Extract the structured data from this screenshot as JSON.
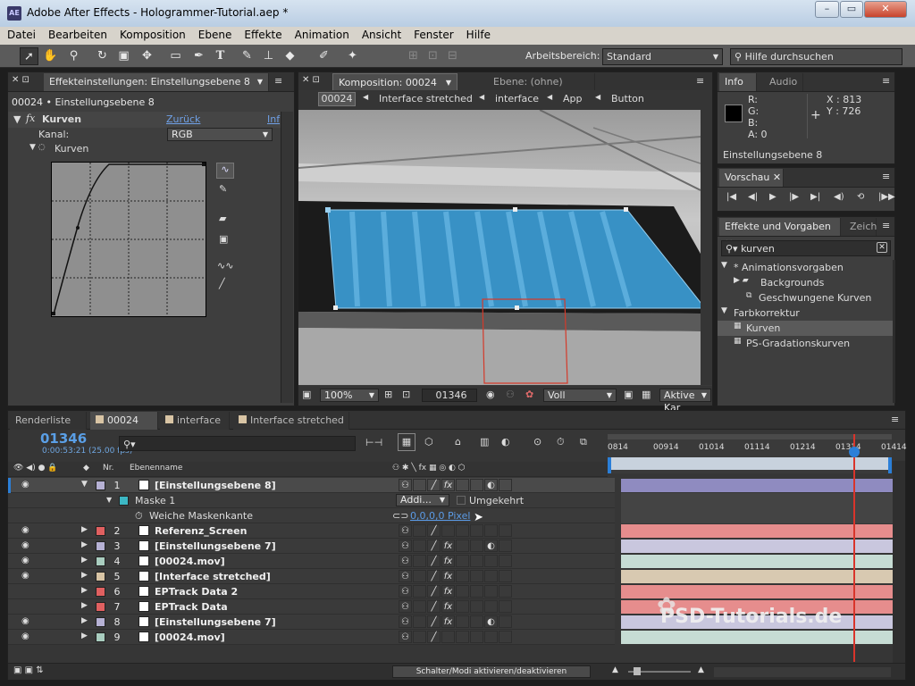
{
  "window": {
    "title": "Adobe After Effects - Hologrammer-Tutorial.aep *",
    "icon_label": "AE"
  },
  "menu": [
    "Datei",
    "Bearbeiten",
    "Komposition",
    "Ebene",
    "Effekte",
    "Animation",
    "Ansicht",
    "Fenster",
    "Hilfe"
  ],
  "toolbar": {
    "workspace_label": "Arbeitsbereich:",
    "workspace_value": "Standard",
    "help_placeholder": "Hilfe durchsuchen"
  },
  "effects_panel": {
    "tab": "Effekteinstellungen: Einstellungsebene 8",
    "breadcrumb": "00024 • Einstellungsebene 8",
    "effect_name": "Kurven",
    "reset": "Zurück",
    "info_link": "Inf",
    "channel_label": "Kanal:",
    "channel_value": "RGB",
    "curves_label": "Kurven"
  },
  "comp_panel": {
    "tab": "Komposition: 00024",
    "tab2": "Ebene: (ohne)",
    "crumbs": [
      "00024",
      "Interface stretched",
      "interface",
      "App",
      "Button"
    ],
    "zoom": "100%",
    "timecode": "01346",
    "resolution": "Voll",
    "camera": "Aktive Kar"
  },
  "info_panel": {
    "tabs": [
      "Info",
      "Audio"
    ],
    "r": "R:",
    "g": "G:",
    "b": "B:",
    "a": "A:  0",
    "x": "X : 813",
    "y": "Y : 726",
    "layer": "Einstellungsebene 8"
  },
  "preview_panel": {
    "tab": "Vorschau"
  },
  "presets_panel": {
    "tabs": [
      "Effekte und Vorgaben",
      "Zeich"
    ],
    "search": "kurven",
    "tree": [
      {
        "text": "* Animationsvorgaben",
        "level": 0,
        "kind": "open"
      },
      {
        "text": "Backgrounds",
        "level": 1,
        "kind": "folder"
      },
      {
        "text": "Geschwungene Kurven",
        "level": 2,
        "kind": "preset"
      },
      {
        "text": "Farbkorrektur",
        "level": 0,
        "kind": "open"
      },
      {
        "text": "Kurven",
        "level": 1,
        "kind": "effect",
        "selected": true
      },
      {
        "text": "PS-Gradationskurven",
        "level": 1,
        "kind": "effect"
      }
    ]
  },
  "timeline": {
    "tabs": [
      "Renderliste",
      "00024",
      "interface",
      "Interface stretched"
    ],
    "timecode": "01346",
    "timecode_sub": "0:00:53:21 (25.00 fps)",
    "col_nr": "Nr.",
    "col_name": "Ebenenname",
    "ruler": [
      "0814",
      "00914",
      "01014",
      "01114",
      "01214",
      "01314",
      "01414"
    ],
    "mask_name": "Maske 1",
    "mask_mode": "Addi...",
    "mask_invert": "Umgekehrt",
    "feather_label": "Weiche Maskenkante",
    "feather_value": "0,0,0,0 Pixel",
    "footer": "Schalter/Modi aktivieren/deaktivieren",
    "layers": [
      {
        "nr": "1",
        "name": "[Einstellungsebene 8]",
        "color": "#b6b1d4",
        "bar": "#8f8bc0",
        "eye": true,
        "fx": true
      },
      {
        "nr": "2",
        "name": "Referenz_Screen",
        "color": "#e06060",
        "bar": "#e68d8d",
        "eye": true,
        "fx": false
      },
      {
        "nr": "3",
        "name": "[Einstellungsebene 7]",
        "color": "#b6b1d4",
        "bar": "#c9c7de",
        "eye": true,
        "fx": true
      },
      {
        "nr": "4",
        "name": "[00024.mov]",
        "color": "#a9cdbf",
        "bar": "#c6dcd4",
        "eye": true,
        "fx": true
      },
      {
        "nr": "5",
        "name": "[Interface stretched]",
        "color": "#d8c4a4",
        "bar": "#d8c9b1",
        "eye": true,
        "fx": true
      },
      {
        "nr": "6",
        "name": "EPTrack Data 2",
        "color": "#e06060",
        "bar": "#e68d8d",
        "eye": false,
        "fx": true
      },
      {
        "nr": "7",
        "name": "EPTrack Data",
        "color": "#e06060",
        "bar": "#e68d8d",
        "eye": false,
        "fx": true
      },
      {
        "nr": "8",
        "name": "[Einstellungsebene 7]",
        "color": "#b6b1d4",
        "bar": "#c9c7de",
        "eye": true,
        "fx": true
      },
      {
        "nr": "9",
        "name": "[00024.mov]",
        "color": "#a9cdbf",
        "bar": "#c6dcd4",
        "eye": true,
        "fx": false
      }
    ]
  },
  "watermark": "PSD-Tutorials.de",
  "colors": {
    "accent": "#4a90d9",
    "playhead": "#d9342b"
  }
}
